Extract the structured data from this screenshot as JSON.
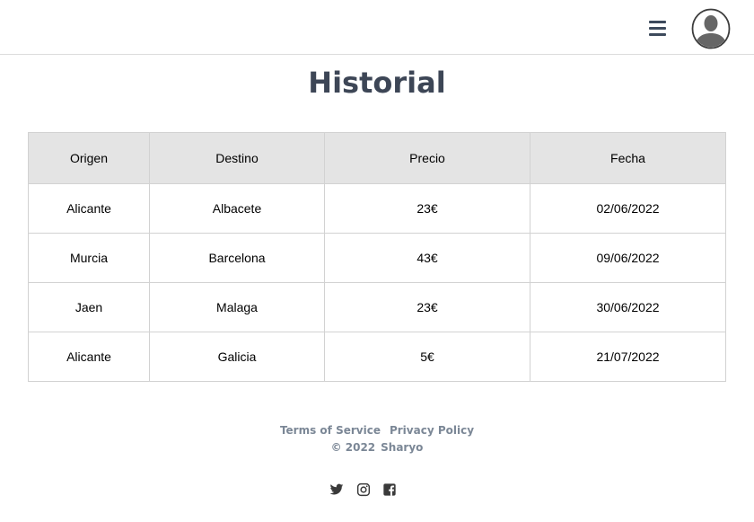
{
  "header": {
    "menu_icon": "hamburger-menu-icon",
    "avatar_icon": "user-avatar-icon"
  },
  "page": {
    "title": "Historial"
  },
  "table": {
    "columns": [
      "Origen",
      "Destino",
      "Precio",
      "Fecha"
    ],
    "rows": [
      [
        "Alicante",
        "Albacete",
        "23€",
        "02/06/2022"
      ],
      [
        "Murcia",
        "Barcelona",
        "43€",
        "09/06/2022"
      ],
      [
        "Jaen",
        "Malaga",
        "23€",
        "30/06/2022"
      ],
      [
        "Alicante",
        "Galicia",
        "5€",
        "21/07/2022"
      ]
    ]
  },
  "footer": {
    "terms": "Terms of Service",
    "privacy": "Privacy Policy",
    "copyright": "© 2022",
    "brand": "Sharyo",
    "social": [
      "twitter-icon",
      "instagram-icon",
      "facebook-icon"
    ]
  },
  "colors": {
    "heading": "#3d4656",
    "header_row_bg": "#e4e4e4",
    "footer_text": "#7b8796"
  }
}
